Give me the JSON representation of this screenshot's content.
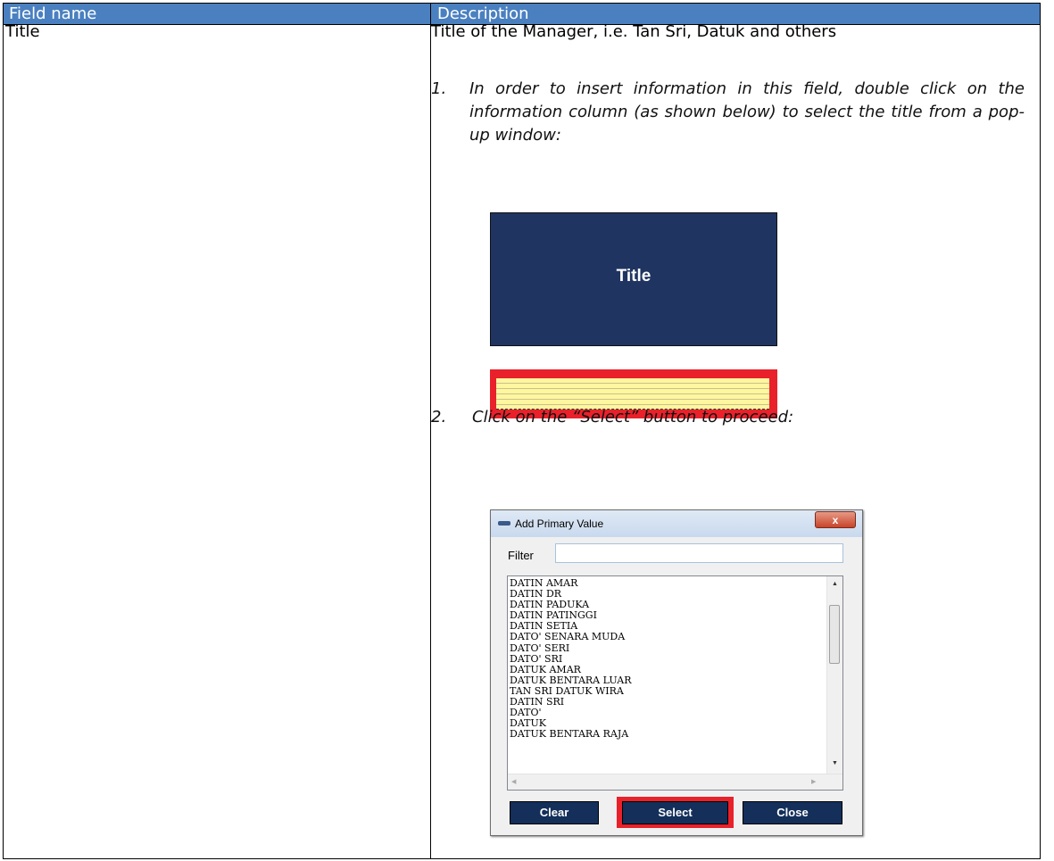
{
  "table": {
    "header": {
      "field_name": "Field name",
      "description": "Description"
    },
    "row": {
      "field_name": "Title",
      "description": "Title of the Manager, i.e. Tan Sri, Datuk and others",
      "steps": [
        {
          "number": "1.",
          "text": "In order to insert information in this field, double click on the information column (as shown below) to select the title from a pop-up window:"
        },
        {
          "number": "2.",
          "text": "Click on the “Select” button to proceed:"
        }
      ]
    }
  },
  "figure_title": {
    "label": "Title"
  },
  "dialog": {
    "title": "Add Primary Value",
    "close_glyph": "x",
    "filter_label": "Filter",
    "filter_value": "",
    "items": [
      "DATIN AMAR",
      "DATIN DR",
      "DATIN PADUKA",
      "DATIN PATINGGI",
      "DATIN SETIA",
      "DATO' SENARA MUDA",
      "DATO' SERI",
      "DATO' SRI",
      "DATUK AMAR",
      "DATUK BENTARA LUAR",
      "TAN SRI DATUK WIRA",
      "DATIN SRI",
      "DATO'",
      "DATUK",
      "DATUK BENTARA RAJA"
    ],
    "buttons": {
      "clear": "Clear",
      "select": "Select",
      "close": "Close"
    }
  },
  "colors": {
    "header_bg": "#4a80c0",
    "title_box_bg": "#1f3461",
    "highlight_red": "#e8212b",
    "field_yellow": "#fff6a0",
    "dialog_button_bg": "#132f5a"
  }
}
